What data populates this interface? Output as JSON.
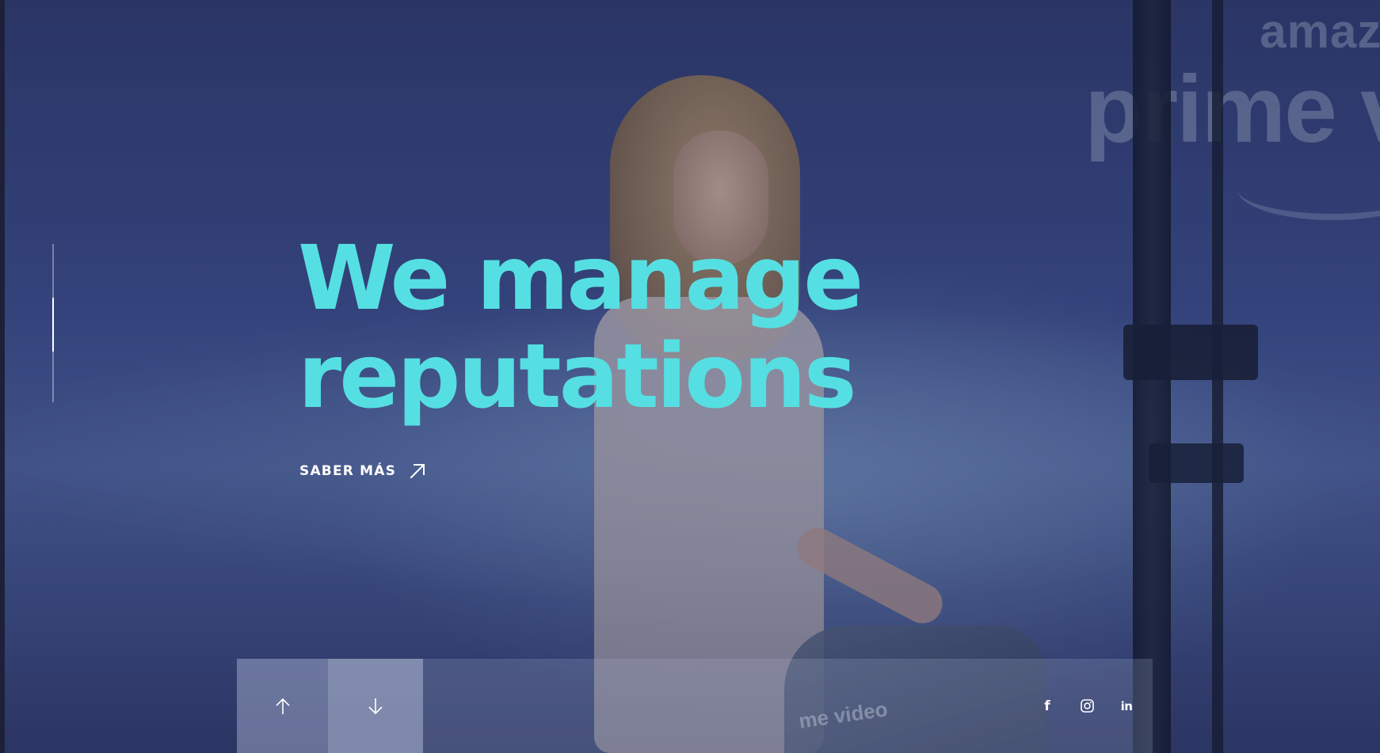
{
  "hero": {
    "headline_line1": "We manage",
    "headline_line2": "reputations",
    "cta_label": "SABER MÁS",
    "cta_icon": "arrow-up-right-icon",
    "headline_color": "#56dfe2"
  },
  "backdrop": {
    "logo_line1": "amazo",
    "logo_line2": "prime v",
    "bag_text": "me video"
  },
  "slider": {
    "slides_total": 3,
    "active_slide": 2
  },
  "nav": {
    "prev_icon": "arrow-up-icon",
    "next_icon": "arrow-down-icon"
  },
  "socials": {
    "facebook_glyph": "f",
    "facebook_icon": "facebook-icon",
    "instagram_icon": "instagram-icon",
    "linkedin_glyph": "in",
    "linkedin_icon": "linkedin-icon"
  }
}
